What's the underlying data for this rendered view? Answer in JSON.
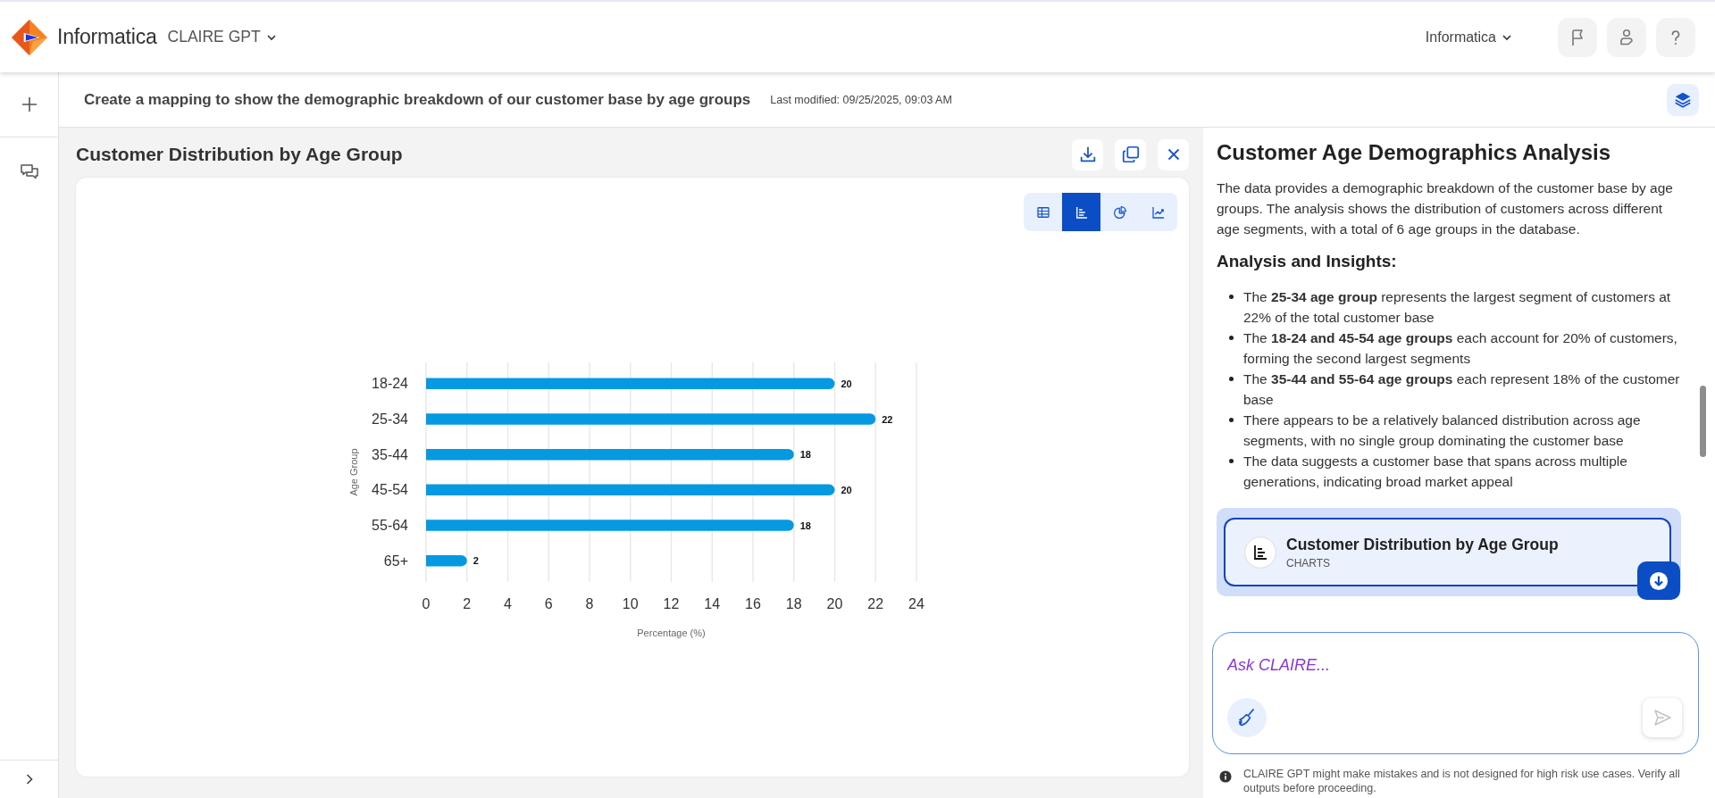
{
  "top_bar": {
    "brand": "Informatica",
    "product": "CLAIRE GPT",
    "organization": "Informatica"
  },
  "conversation": {
    "title": "Create a mapping to show the demographic breakdown of our customer base by age groups",
    "last_modified": "Last modified: 09/25/2025, 09:03 AM"
  },
  "chart_panel": {
    "title": "Customer Distribution by Age Group",
    "view_options": [
      {
        "kind": "table",
        "selected": false
      },
      {
        "kind": "bar",
        "selected": true
      },
      {
        "kind": "pie",
        "selected": false
      },
      {
        "kind": "line",
        "selected": false
      }
    ],
    "chart_data": {
      "type": "bar",
      "orientation": "horizontal",
      "xlabel": "Percentage (%)",
      "ylabel": "Age Group",
      "categories": [
        "18-24",
        "25-34",
        "35-44",
        "45-54",
        "55-64",
        "65+"
      ],
      "values": [
        20,
        22,
        18,
        20,
        18,
        2
      ],
      "xlim": [
        0,
        24
      ],
      "xticks": [
        0,
        2,
        4,
        6,
        8,
        10,
        12,
        14,
        16,
        18,
        20,
        22,
        24
      ],
      "grid": true,
      "data_labels": true
    }
  },
  "analysis": {
    "title": "Customer Age Demographics Analysis",
    "intro": "The data provides a demographic breakdown of the customer base by age groups. The analysis shows the distribution of customers across different age segments, with a total of 6 age groups in the database.",
    "insights_heading": "Analysis and Insights:",
    "insights": [
      "The **25-34 age group** represents the largest segment of customers at 22% of the total customer base",
      "The **18-24 and 45-54 age groups** each account for 20% of customers, forming the second largest segments",
      "The **35-44 and 55-64 age groups** each represent 18% of the customer base",
      "There appears to be a relatively balanced distribution across age segments, with no single group dominating the customer base",
      "The data suggests a customer base that spans across multiple generations, indicating broad market appeal"
    ]
  },
  "artifact": {
    "title": "Customer Distribution by Age Group",
    "type": "CHARTS"
  },
  "prompt": {
    "placeholder": "Ask CLAIRE..."
  },
  "disclaimer": "CLAIRE GPT might make mistakes and is not designed for high risk use cases. Verify all outputs before proceeding."
}
